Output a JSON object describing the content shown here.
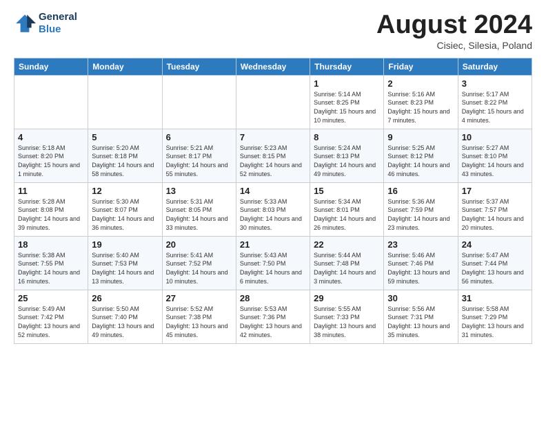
{
  "header": {
    "logo_line1": "General",
    "logo_line2": "Blue",
    "month": "August 2024",
    "location": "Cisiec, Silesia, Poland"
  },
  "days_of_week": [
    "Sunday",
    "Monday",
    "Tuesday",
    "Wednesday",
    "Thursday",
    "Friday",
    "Saturday"
  ],
  "weeks": [
    [
      {
        "day": "",
        "text": ""
      },
      {
        "day": "",
        "text": ""
      },
      {
        "day": "",
        "text": ""
      },
      {
        "day": "",
        "text": ""
      },
      {
        "day": "1",
        "text": "Sunrise: 5:14 AM\nSunset: 8:25 PM\nDaylight: 15 hours and 10 minutes."
      },
      {
        "day": "2",
        "text": "Sunrise: 5:16 AM\nSunset: 8:23 PM\nDaylight: 15 hours and 7 minutes."
      },
      {
        "day": "3",
        "text": "Sunrise: 5:17 AM\nSunset: 8:22 PM\nDaylight: 15 hours and 4 minutes."
      }
    ],
    [
      {
        "day": "4",
        "text": "Sunrise: 5:18 AM\nSunset: 8:20 PM\nDaylight: 15 hours and 1 minute."
      },
      {
        "day": "5",
        "text": "Sunrise: 5:20 AM\nSunset: 8:18 PM\nDaylight: 14 hours and 58 minutes."
      },
      {
        "day": "6",
        "text": "Sunrise: 5:21 AM\nSunset: 8:17 PM\nDaylight: 14 hours and 55 minutes."
      },
      {
        "day": "7",
        "text": "Sunrise: 5:23 AM\nSunset: 8:15 PM\nDaylight: 14 hours and 52 minutes."
      },
      {
        "day": "8",
        "text": "Sunrise: 5:24 AM\nSunset: 8:13 PM\nDaylight: 14 hours and 49 minutes."
      },
      {
        "day": "9",
        "text": "Sunrise: 5:25 AM\nSunset: 8:12 PM\nDaylight: 14 hours and 46 minutes."
      },
      {
        "day": "10",
        "text": "Sunrise: 5:27 AM\nSunset: 8:10 PM\nDaylight: 14 hours and 43 minutes."
      }
    ],
    [
      {
        "day": "11",
        "text": "Sunrise: 5:28 AM\nSunset: 8:08 PM\nDaylight: 14 hours and 39 minutes."
      },
      {
        "day": "12",
        "text": "Sunrise: 5:30 AM\nSunset: 8:07 PM\nDaylight: 14 hours and 36 minutes."
      },
      {
        "day": "13",
        "text": "Sunrise: 5:31 AM\nSunset: 8:05 PM\nDaylight: 14 hours and 33 minutes."
      },
      {
        "day": "14",
        "text": "Sunrise: 5:33 AM\nSunset: 8:03 PM\nDaylight: 14 hours and 30 minutes."
      },
      {
        "day": "15",
        "text": "Sunrise: 5:34 AM\nSunset: 8:01 PM\nDaylight: 14 hours and 26 minutes."
      },
      {
        "day": "16",
        "text": "Sunrise: 5:36 AM\nSunset: 7:59 PM\nDaylight: 14 hours and 23 minutes."
      },
      {
        "day": "17",
        "text": "Sunrise: 5:37 AM\nSunset: 7:57 PM\nDaylight: 14 hours and 20 minutes."
      }
    ],
    [
      {
        "day": "18",
        "text": "Sunrise: 5:38 AM\nSunset: 7:55 PM\nDaylight: 14 hours and 16 minutes."
      },
      {
        "day": "19",
        "text": "Sunrise: 5:40 AM\nSunset: 7:53 PM\nDaylight: 14 hours and 13 minutes."
      },
      {
        "day": "20",
        "text": "Sunrise: 5:41 AM\nSunset: 7:52 PM\nDaylight: 14 hours and 10 minutes."
      },
      {
        "day": "21",
        "text": "Sunrise: 5:43 AM\nSunset: 7:50 PM\nDaylight: 14 hours and 6 minutes."
      },
      {
        "day": "22",
        "text": "Sunrise: 5:44 AM\nSunset: 7:48 PM\nDaylight: 14 hours and 3 minutes."
      },
      {
        "day": "23",
        "text": "Sunrise: 5:46 AM\nSunset: 7:46 PM\nDaylight: 13 hours and 59 minutes."
      },
      {
        "day": "24",
        "text": "Sunrise: 5:47 AM\nSunset: 7:44 PM\nDaylight: 13 hours and 56 minutes."
      }
    ],
    [
      {
        "day": "25",
        "text": "Sunrise: 5:49 AM\nSunset: 7:42 PM\nDaylight: 13 hours and 52 minutes."
      },
      {
        "day": "26",
        "text": "Sunrise: 5:50 AM\nSunset: 7:40 PM\nDaylight: 13 hours and 49 minutes."
      },
      {
        "day": "27",
        "text": "Sunrise: 5:52 AM\nSunset: 7:38 PM\nDaylight: 13 hours and 45 minutes."
      },
      {
        "day": "28",
        "text": "Sunrise: 5:53 AM\nSunset: 7:36 PM\nDaylight: 13 hours and 42 minutes."
      },
      {
        "day": "29",
        "text": "Sunrise: 5:55 AM\nSunset: 7:33 PM\nDaylight: 13 hours and 38 minutes."
      },
      {
        "day": "30",
        "text": "Sunrise: 5:56 AM\nSunset: 7:31 PM\nDaylight: 13 hours and 35 minutes."
      },
      {
        "day": "31",
        "text": "Sunrise: 5:58 AM\nSunset: 7:29 PM\nDaylight: 13 hours and 31 minutes."
      }
    ]
  ]
}
